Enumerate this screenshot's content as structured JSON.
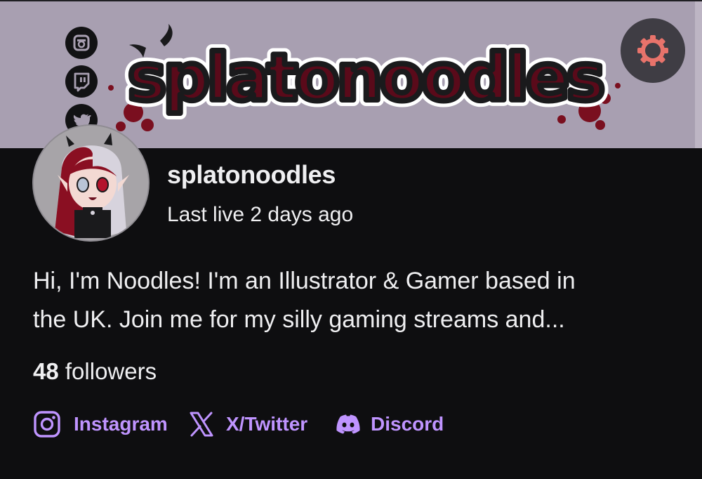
{
  "banner": {
    "logo_text": "splatonoodles",
    "colors": {
      "background": "#a89fb1",
      "logo_fill": "#5a0a1a",
      "logo_outline": "#ffffff",
      "splatter": "#7a0f1f"
    },
    "social_icons": [
      "instagram-icon",
      "twitch-icon",
      "twitter-icon"
    ]
  },
  "settings": {
    "icon": "gear-icon",
    "color": "#e8736b"
  },
  "profile": {
    "channel_name": "splatonoodles",
    "last_live": "Last live 2 days ago",
    "bio_line1": "Hi, I'm Noodles! I'm an Illustrator & Gamer based in",
    "bio_line2": "the UK. Join me for my silly gaming streams and...",
    "followers_count": "48",
    "followers_label": "followers"
  },
  "links": [
    {
      "label": "Instagram",
      "icon": "instagram-icon"
    },
    {
      "label": "X/Twitter",
      "icon": "x-icon"
    },
    {
      "label": "Discord",
      "icon": "discord-icon"
    }
  ],
  "colors": {
    "page_background": "#0e0e10",
    "text": "#efeff1",
    "link": "#bf94ff"
  }
}
